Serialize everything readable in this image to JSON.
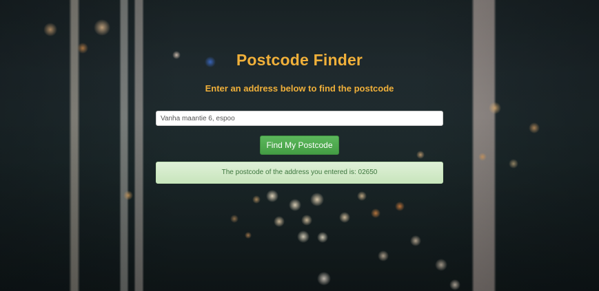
{
  "page": {
    "title": "Postcode Finder",
    "subtitle": "Enter an address below to find the postcode"
  },
  "search": {
    "value": "Vanha maantie 6, espoo",
    "placeholder": ""
  },
  "actions": {
    "find_label": "Find My Postcode"
  },
  "result": {
    "message": "The postcode of the address you entered is: 02650"
  },
  "colors": {
    "heading": "#f0b03a",
    "button": "#5cb85c",
    "alert_bg": "#dff0d8",
    "alert_text": "#3c763d"
  }
}
